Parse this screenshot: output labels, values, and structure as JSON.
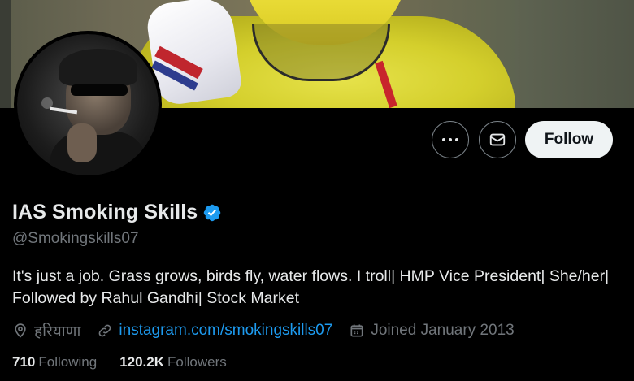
{
  "profile": {
    "display_name": "IAS Smoking Skills",
    "handle": "@Smokingskills07",
    "bio": "It's just a job. Grass grows, birds fly, water flows. I troll| HMP Vice President| She/her| Followed by Rahul Gandhi| Stock Market",
    "location": "हरियाणा",
    "website": "instagram.com/smokingskills07",
    "joined": "Joined January 2013",
    "verified": true
  },
  "actions": {
    "follow_label": "Follow",
    "more_icon": "more-horizontal-icon",
    "message_icon": "envelope-icon"
  },
  "stats": {
    "following_count": "710",
    "following_label": "Following",
    "followers_count": "120.2K",
    "followers_label": "Followers"
  },
  "colors": {
    "background": "#000000",
    "text_primary": "#e7e9ea",
    "text_secondary": "#71767b",
    "link": "#1d9bf0",
    "verified_badge": "#1d9bf0",
    "follow_button_bg": "#eff3f4"
  }
}
